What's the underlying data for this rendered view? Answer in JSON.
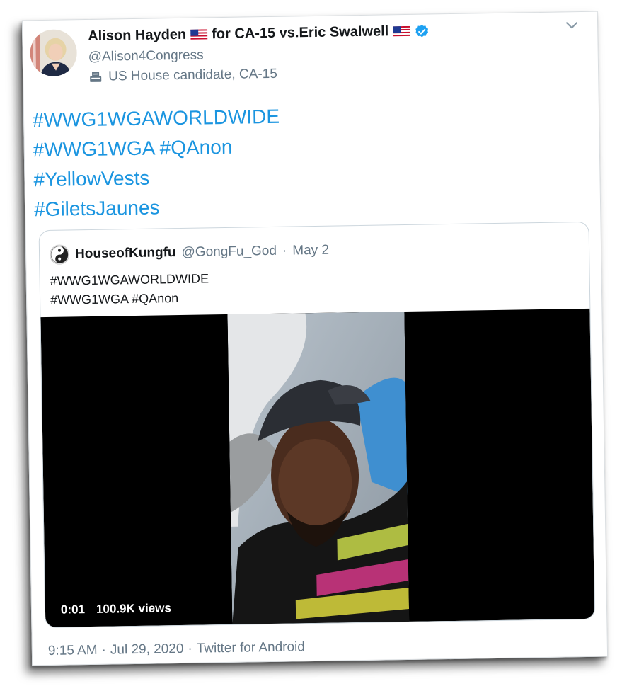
{
  "tweet": {
    "author": {
      "name": "Alison Hayden",
      "name_suffix": "for CA-15 vs.Eric Swalwell",
      "handle": "@Alison4Congress",
      "bio": "US House candidate, CA-15",
      "verified": true
    },
    "hashtags": [
      "#WWG1WGAWORLDWIDE",
      "#WWG1WGA #QAnon",
      "#YellowVests",
      "#GiletsJaunes"
    ],
    "quoted": {
      "name": "HouseofKungfu",
      "handle": "@GongFu_God",
      "separator": "·",
      "date": "May 2",
      "text_lines": [
        "#WWG1WGAWORLDWIDE",
        "#WWG1WGA #QAnon"
      ],
      "video": {
        "time": "0:01",
        "views": "100.9K views"
      }
    },
    "footer": {
      "time": "9:15 AM",
      "sep1": "·",
      "date": "Jul 29, 2020",
      "sep2": "·",
      "source": "Twitter for Android"
    }
  },
  "colors": {
    "link": "#1b95e0",
    "secondary_text": "#657786",
    "verified": "#1da1f2"
  },
  "icons": [
    "chevron-down-icon",
    "verified-badge-icon",
    "ballot-box-icon",
    "us-flag-icon"
  ]
}
